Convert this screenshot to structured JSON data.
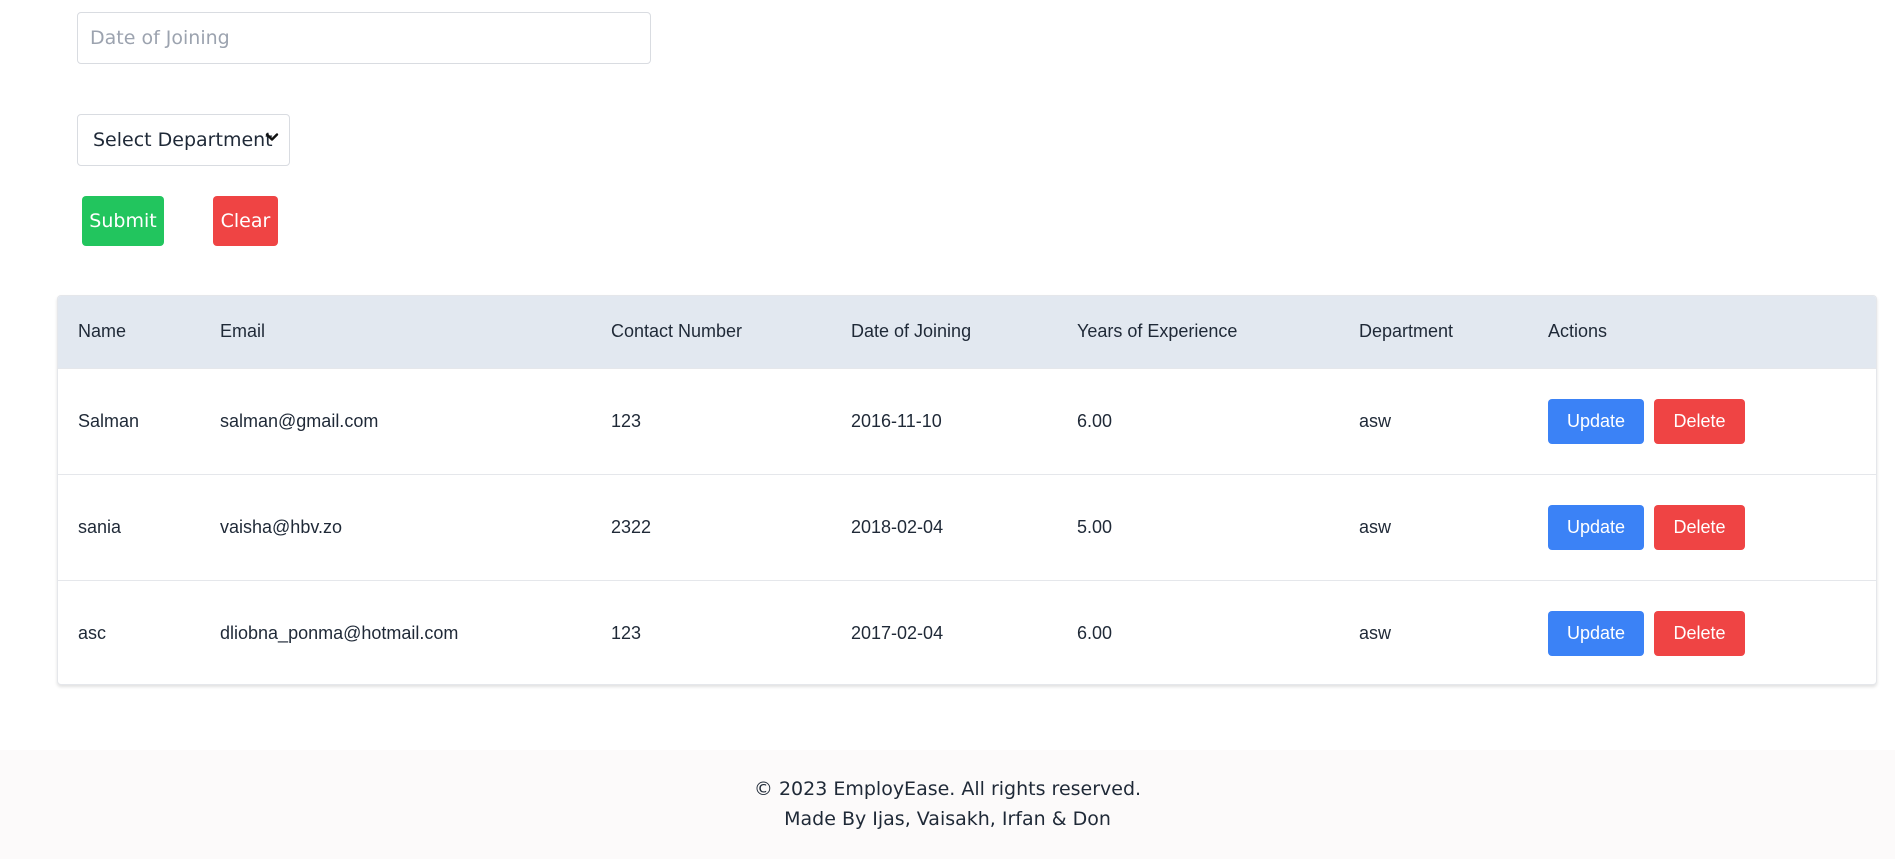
{
  "form": {
    "date_placeholder": "Date of Joining",
    "department_select": "Select Department",
    "submit_label": "Submit",
    "clear_label": "Clear"
  },
  "table": {
    "headers": [
      "Name",
      "Email",
      "Contact Number",
      "Date of Joining",
      "Years of Experience",
      "Department",
      "Actions"
    ],
    "rows": [
      {
        "name": "Salman",
        "email": "salman@gmail.com",
        "contact": "123",
        "doj": "2016-11-10",
        "experience": "6.00",
        "department": "asw"
      },
      {
        "name": "sania",
        "email": "vaisha@hbv.zo",
        "contact": "2322",
        "doj": "2018-02-04",
        "experience": "5.00",
        "department": "asw"
      },
      {
        "name": "asc",
        "email": "dliobna_ponma@hotmail.com",
        "contact": "123",
        "doj": "2017-02-04",
        "experience": "6.00",
        "department": "asw"
      }
    ],
    "update_label": "Update",
    "delete_label": "Delete"
  },
  "footer": {
    "copyright": "© 2023 EmployEase. All rights reserved.",
    "credits": "Made By Ijas, Vaisakh, Irfan & Don"
  },
  "colors": {
    "success": "#22c55e",
    "danger": "#ef4444",
    "primary": "#3b82f6",
    "table_header_bg": "#e2e8f0"
  }
}
